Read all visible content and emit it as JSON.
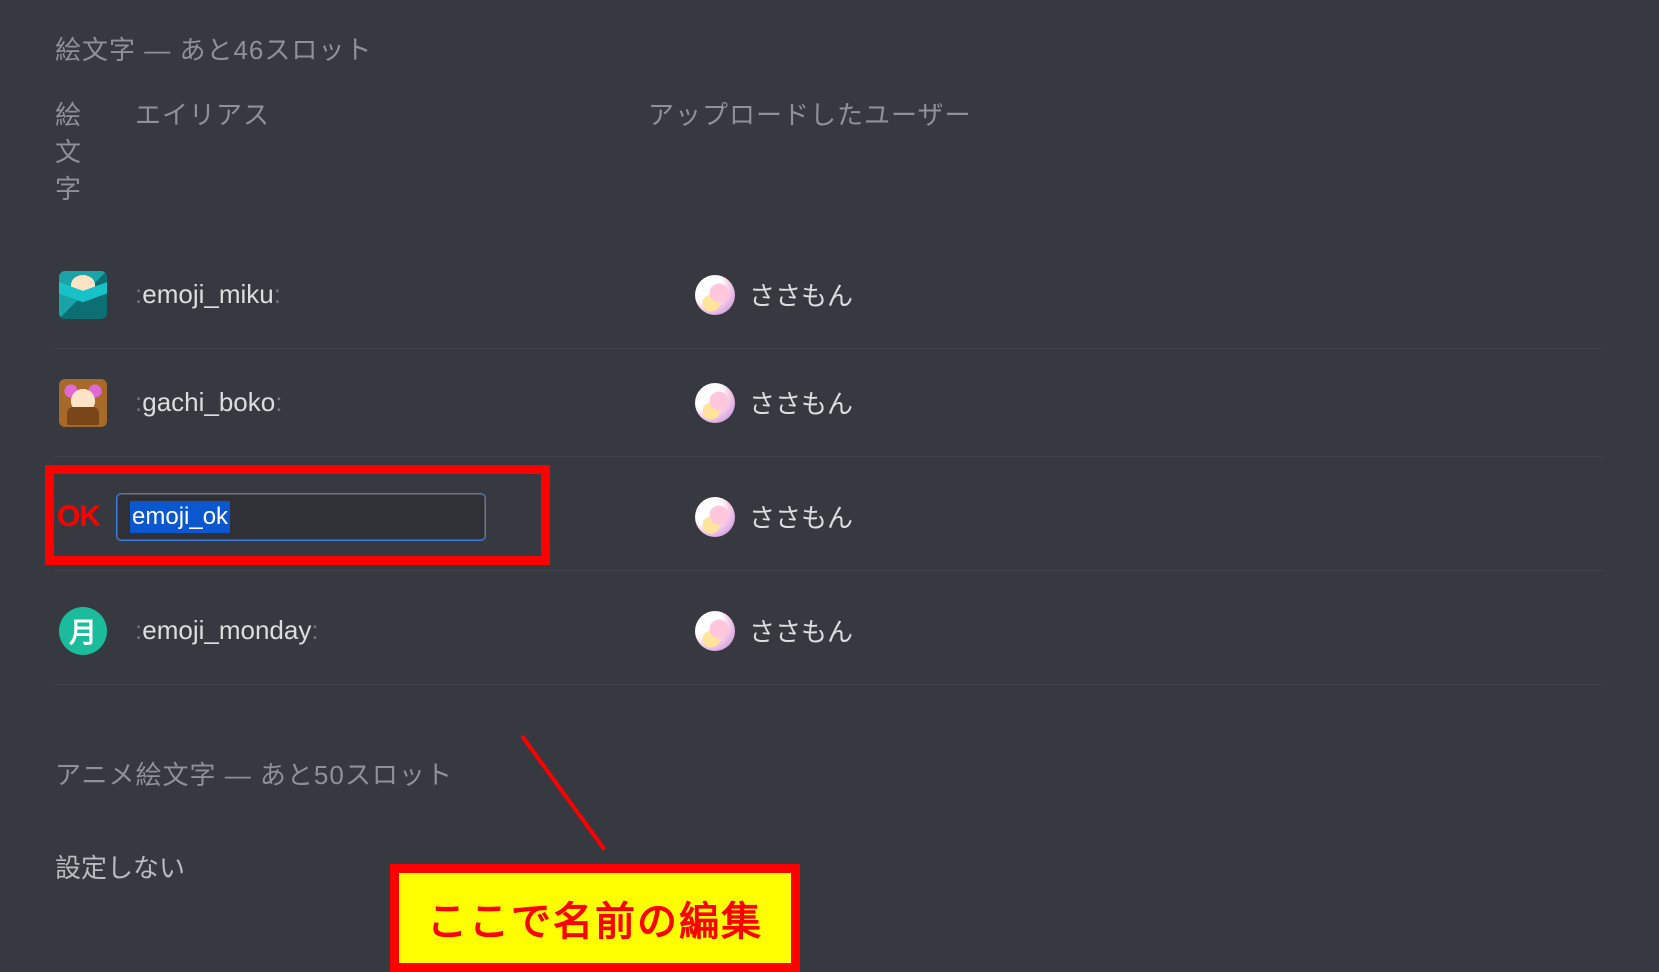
{
  "section1": {
    "title": "絵文字 — あと46スロット"
  },
  "headers": {
    "emoji": "絵文字",
    "alias": "エイリアス",
    "uploader": "アップロードしたユーザー"
  },
  "rows": [
    {
      "alias": "emoji_miku",
      "uploader": "ささもん",
      "icon": "miku"
    },
    {
      "alias": "gachi_boko",
      "uploader": "ささもん",
      "icon": "gachi"
    },
    {
      "alias": "emoji_ok",
      "uploader": "ささもん",
      "icon": "ok",
      "editing": true
    },
    {
      "alias": "emoji_monday",
      "uploader": "ささもん",
      "icon": "monday",
      "icon_text": "月"
    }
  ],
  "callout": {
    "text": "ここで名前の編集"
  },
  "section2": {
    "title": "アニメ絵文字 — あと50スロット",
    "empty": "設定しない"
  },
  "colors": {
    "highlight_border": "#ff0000",
    "highlight_bg": "#ffff00",
    "bg": "#36393f",
    "input_bg": "#2f3136",
    "selection_bg": "#0b57d0"
  }
}
